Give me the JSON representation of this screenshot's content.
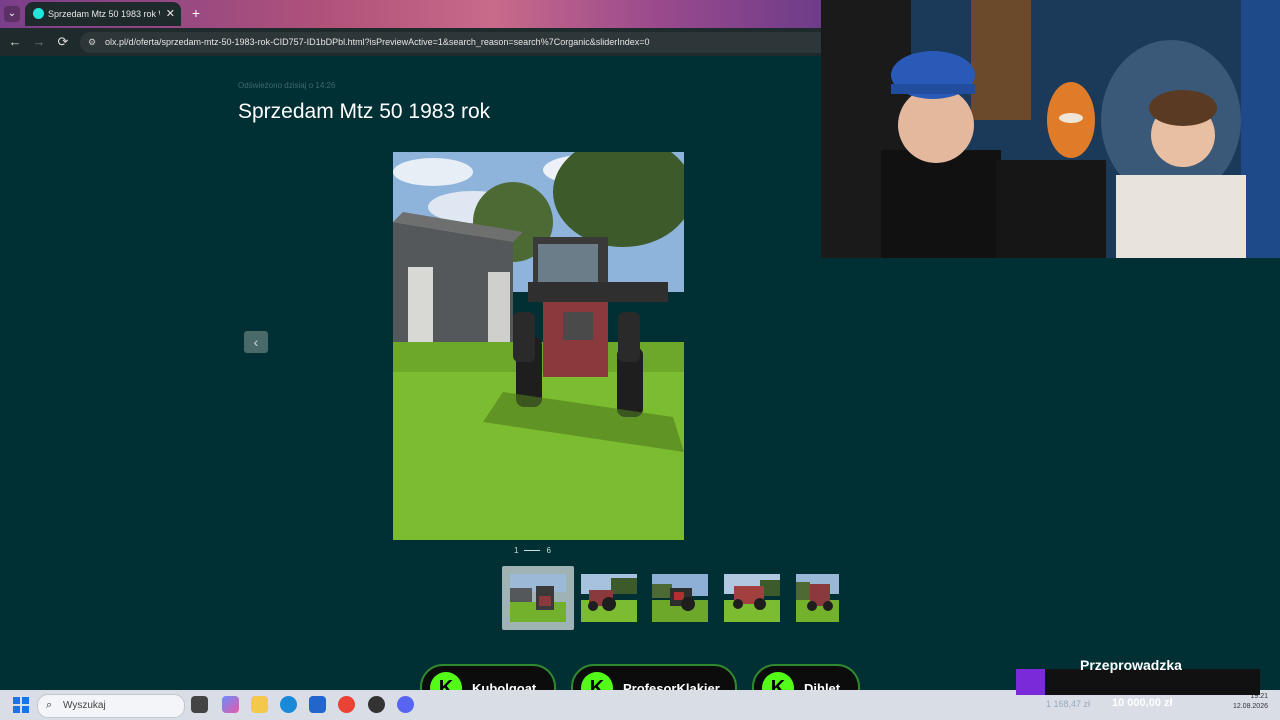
{
  "browser": {
    "tab_title": "Sprzedam Mtz 50 1983 rok Wi...",
    "tab_close": "✕",
    "new_tab": "+",
    "tab_list": "⌄",
    "url": "olx.pl/d/oferta/sprzedam-mtz-50-1983-rok-CID757-ID1bDPbl.html?isPreviewActive=1&search_reason=search%7Corganic&sliderIndex=0",
    "nav": {
      "back": "←",
      "forward": "→",
      "reload": "⟳"
    }
  },
  "listing": {
    "refreshed": "Odświeżono dzisiaj o 14:26",
    "title": "Sprzedam Mtz 50 1983 rok",
    "prev_arrow": "‹",
    "counter_current": "1",
    "counter_total": "6",
    "thumbnails": [
      "photo 1",
      "photo 2",
      "photo 3",
      "photo 4",
      "photo 5"
    ],
    "selected_thumbnail": 0
  },
  "stream": {
    "kick_letter": "K",
    "pills": [
      "Kubolgoat",
      "ProfesorKlakier",
      "Dihlet"
    ],
    "goal_title": "Przeprowadzka",
    "goal_current": "1 168,47 zł",
    "goal_target": "10 000,00 zł",
    "goal_progress": 0.12
  },
  "taskbar": {
    "search_placeholder": "Wyszukaj",
    "time": "19:21",
    "date": "12.08.2026"
  },
  "colors": {
    "page_bg": "#002f34",
    "olx_accent": "#23e5db",
    "kick_green": "#53fc18"
  }
}
